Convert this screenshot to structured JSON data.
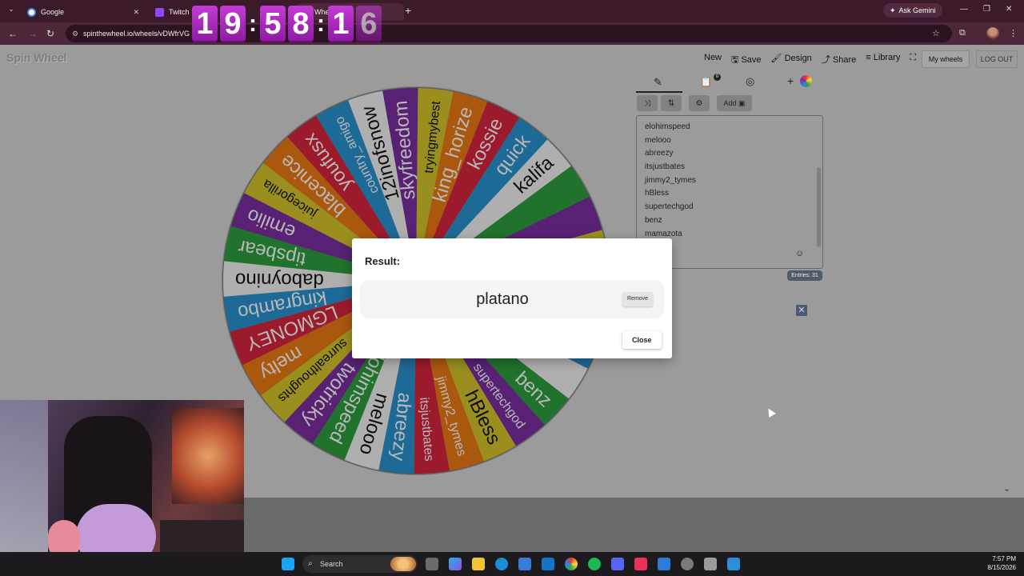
{
  "browser": {
    "tabs": [
      {
        "label": "Google",
        "color": "#4285f4"
      },
      {
        "label": "Twitch",
        "color": "#9146ff"
      },
      {
        "label": "Wheel",
        "color": "#e53935"
      }
    ],
    "ask_gemini": "Ask Gemini",
    "url": "spinthewheel.io/wheels/vDWfrVG"
  },
  "clock": {
    "digits": [
      "1",
      "9",
      "5",
      "8",
      "1",
      "6"
    ]
  },
  "site": {
    "logo": "Spin Wheel",
    "nav": [
      "New",
      "Save",
      "Design",
      "Share",
      "Library"
    ],
    "my_wheels": "My wheels",
    "logout": "LOG OUT",
    "results_badge": "0",
    "add_image": "Add",
    "entries": [
      "elohimspeed",
      "melooo",
      "abreezy",
      "itsjustbates",
      "jimmy2_tymes",
      "hBless",
      "supertechgod",
      "benz",
      "mamazota"
    ],
    "entries_count": "Entries: 31"
  },
  "wheel": {
    "colors": [
      "#7b2fa0",
      "#d4c52a",
      "#ee7a16",
      "#d7263d",
      "#2a93d0",
      "#f3f3f3",
      "#2e9e3e"
    ],
    "segments": [
      "skyfreedom",
      "tryingmybest",
      "king_horize",
      "kossie",
      "quick",
      "kalifa",
      "",
      "",
      "",
      "",
      "",
      "",
      "",
      "benz",
      "supertechgod",
      "hBless",
      "jimmy2_tymes",
      "itsjustbates",
      "abreezy",
      "melooo",
      "elohimspeed",
      "twotricky",
      "surrealthoughts",
      "melty",
      "LGMONEY",
      "kingrambo",
      "daboynino",
      "tipsbear",
      "emilio",
      "juicegorilla",
      "blacenice",
      "youfusx",
      "country_amigo",
      "12inofsnow"
    ]
  },
  "result": {
    "title": "Result:",
    "name": "platano",
    "remove": "Remove",
    "close": "Close"
  },
  "taskbar": {
    "search": "Search",
    "time": "7:57 PM",
    "date": "8/15/2026"
  }
}
